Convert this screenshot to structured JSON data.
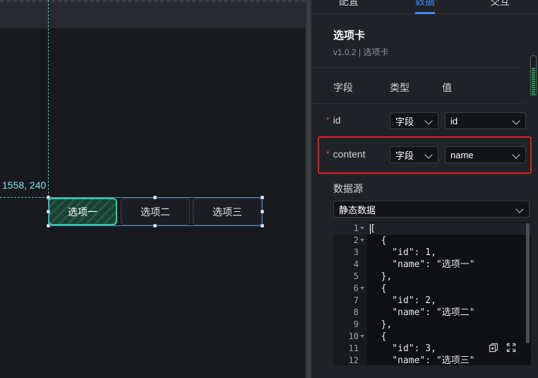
{
  "canvas": {
    "coordinate_readout": "1558, 240",
    "tabs": [
      {
        "label": "选项一",
        "active": true
      },
      {
        "label": "选项二",
        "active": false
      },
      {
        "label": "选项三",
        "active": false
      }
    ]
  },
  "panel": {
    "top_tabs": [
      {
        "label": "配置",
        "active": false
      },
      {
        "label": "数据",
        "active": true
      },
      {
        "label": "交互",
        "active": false
      }
    ],
    "component_title": "选项卡",
    "component_version": "v1.0.2 | 选项卡",
    "columns": {
      "field": "字段",
      "type": "类型",
      "value": "值"
    },
    "fields": [
      {
        "name": "id",
        "type": "字段",
        "value": "id",
        "required": true
      },
      {
        "name": "content",
        "type": "字段",
        "value": "name",
        "required": true,
        "highlighted": true
      }
    ],
    "datasource_label": "数据源",
    "datasource_value": "静态数据",
    "editor_lines": [
      "[",
      "  {",
      "    \"id\": 1,",
      "    \"name\": \"选项一\"",
      "  },",
      "  {",
      "    \"id\": 2,",
      "    \"name\": \"选项二\"",
      "  },",
      "  {",
      "    \"id\": 3,",
      "    \"name\": \"选项三\""
    ],
    "line_numbers": [
      "1",
      "2",
      "3",
      "4",
      "5",
      "6",
      "7",
      "8",
      "9",
      "10",
      "11",
      "12"
    ]
  },
  "colors": {
    "accent": "#3d8bfd",
    "active_tab": "#2fd09a",
    "highlight_box": "#e02020",
    "guide": "#3bc7c7"
  }
}
